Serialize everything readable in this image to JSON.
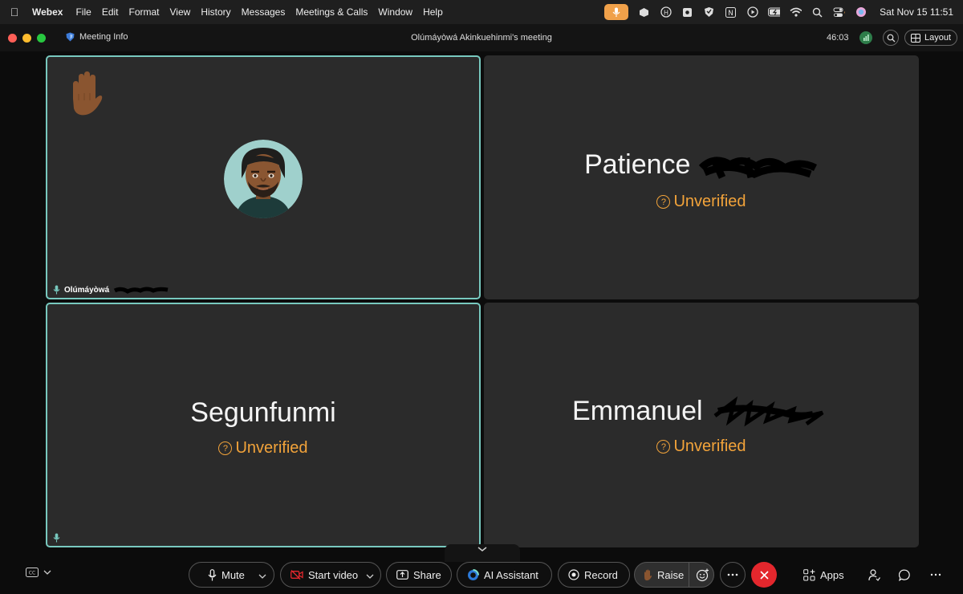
{
  "menubar": {
    "app": "Webex",
    "items": [
      "File",
      "Edit",
      "Format",
      "View",
      "History",
      "Messages",
      "Meetings & Calls",
      "Window",
      "Help"
    ],
    "clock": "Sat Nov 15  11:51"
  },
  "window": {
    "meeting_info_label": "Meeting Info",
    "title": "Olúmáyòwá Akinkuehinmi's meeting",
    "timer": "46:03",
    "layout_label": "Layout"
  },
  "tiles": [
    {
      "name_tag": "Olúmáyòwá",
      "raised_hand": true
    },
    {
      "name": "Patience",
      "status": "Unverified"
    },
    {
      "name": "Segunfunmi",
      "status": "Unverified"
    },
    {
      "name": "Emmanuel",
      "status": "Unverified"
    }
  ],
  "controls": {
    "mute": "Mute",
    "start_video": "Start video",
    "share": "Share",
    "ai_assistant": "AI Assistant",
    "record": "Record",
    "raise": "Raise",
    "apps": "Apps"
  },
  "colors": {
    "accent_active_border": "#78c9bf",
    "unverified": "#f2a33a",
    "end_call": "#e3272d",
    "video_off": "#e3272d",
    "mic_indicator": "#f0a14a"
  }
}
